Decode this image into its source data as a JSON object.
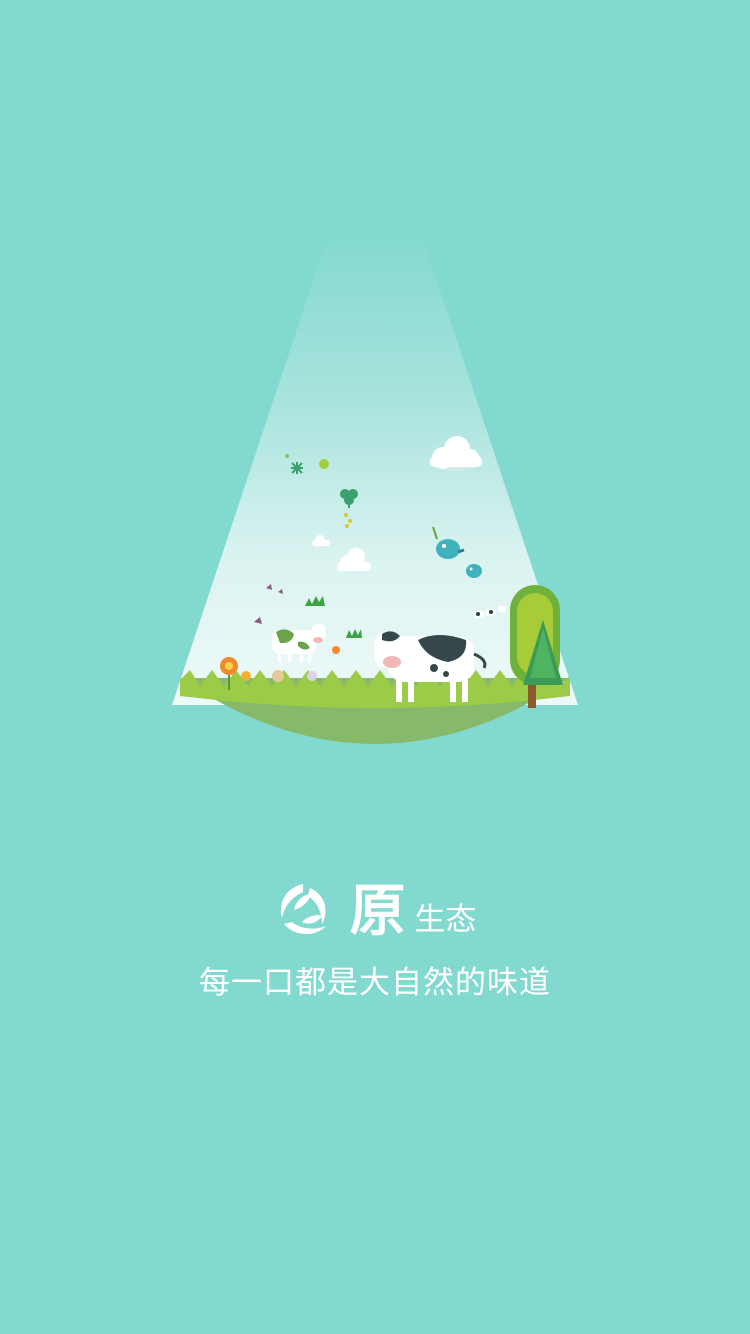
{
  "brand": {
    "logo_icon": "leaf-ring-logo-icon",
    "title_main": "原",
    "title_sub": "生态"
  },
  "slogan": "每一口都是大自然的味道",
  "illustration": {
    "description_icon": "pasture-scene-icon",
    "colors": {
      "background": "#82d9d0",
      "ground": "#86b96a",
      "grass": "#9ccc47",
      "spotlight_top": "#9bdcd5",
      "spotlight_bottom": "#f0fbfa"
    }
  }
}
